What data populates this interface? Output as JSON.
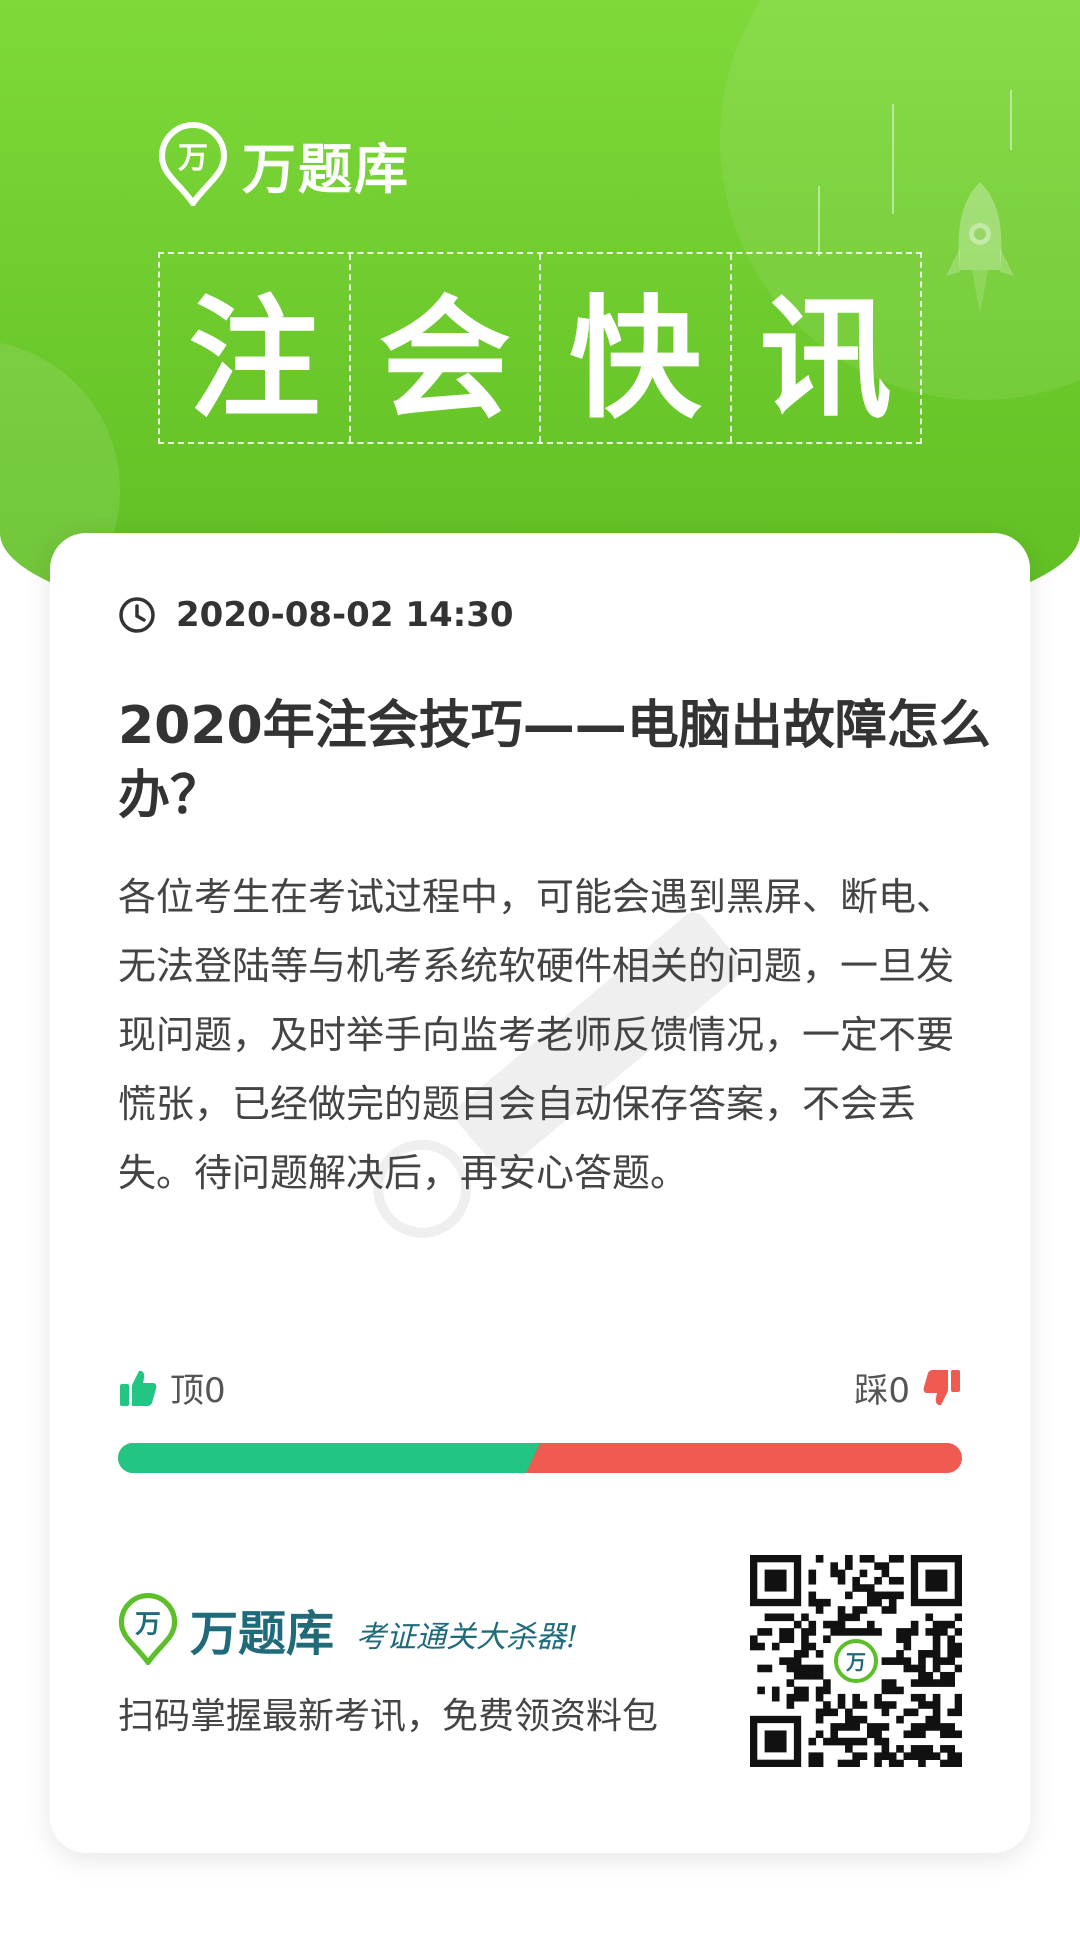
{
  "header": {
    "brand_name": "万题库",
    "logo_char": "万",
    "headline_chars": [
      "注",
      "会",
      "快",
      "讯"
    ]
  },
  "article": {
    "datetime": "2020-08-02 14:30",
    "title": "2020年注会技巧——电脑出故障怎么办？",
    "body": "各位考生在考试过程中，可能会遇到黑屏、断电、无法登陆等与机考系统软硬件相关的问题，一旦发现问题，及时举手向监考老师反馈情况，一定不要慌张，已经做完的题目会自动保存答案，不会丢失。待问题解决后，再安心答题。"
  },
  "votes": {
    "up_label": "顶0",
    "down_label": "踩0",
    "up_fraction": 0.5
  },
  "footer": {
    "brand_name": "万题库",
    "logo_char": "万",
    "slogan": "考证通关大杀器!",
    "cta": "扫码掌握最新考讯，免费领资料包"
  },
  "icons": {
    "clock": "clock-icon",
    "thumb_up": "thumbs-up-icon",
    "thumb_down": "thumbs-down-icon",
    "qr": "qr-code"
  },
  "colors": {
    "header_green": "#6cc92c",
    "up_green": "#22c584",
    "down_red": "#ef5a51",
    "brand_teal": "#1f6b7a"
  }
}
